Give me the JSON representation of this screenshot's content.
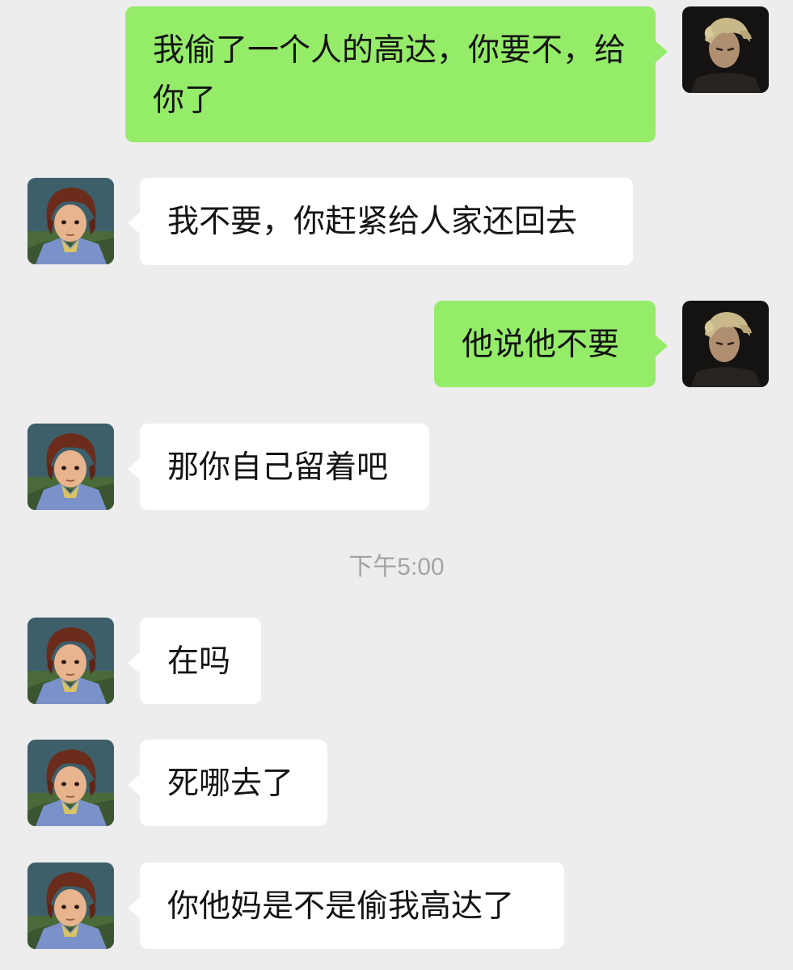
{
  "conversation": {
    "messages": [
      {
        "side": "right",
        "avatar": "blond-character-avatar",
        "text": "我偷了一个人的高达，你要不，给你了"
      },
      {
        "side": "left",
        "avatar": "brown-hair-character-avatar",
        "text": "我不要，你赶紧给人家还回去"
      },
      {
        "side": "right",
        "avatar": "blond-character-avatar",
        "text": "他说他不要"
      },
      {
        "side": "left",
        "avatar": "brown-hair-character-avatar",
        "text": "那你自己留着吧"
      },
      {
        "side": "left",
        "avatar": "brown-hair-character-avatar",
        "text": "在吗"
      },
      {
        "side": "left",
        "avatar": "brown-hair-character-avatar",
        "text": "死哪去了"
      },
      {
        "side": "left",
        "avatar": "brown-hair-character-avatar",
        "text": "你他妈是不是偷我高达了"
      }
    ],
    "timestamp": "下午5:00"
  },
  "colors": {
    "background": "#ededed",
    "outgoing_bubble": "#95ec69",
    "incoming_bubble": "#ffffff",
    "timestamp_text": "#a3a3a3"
  }
}
